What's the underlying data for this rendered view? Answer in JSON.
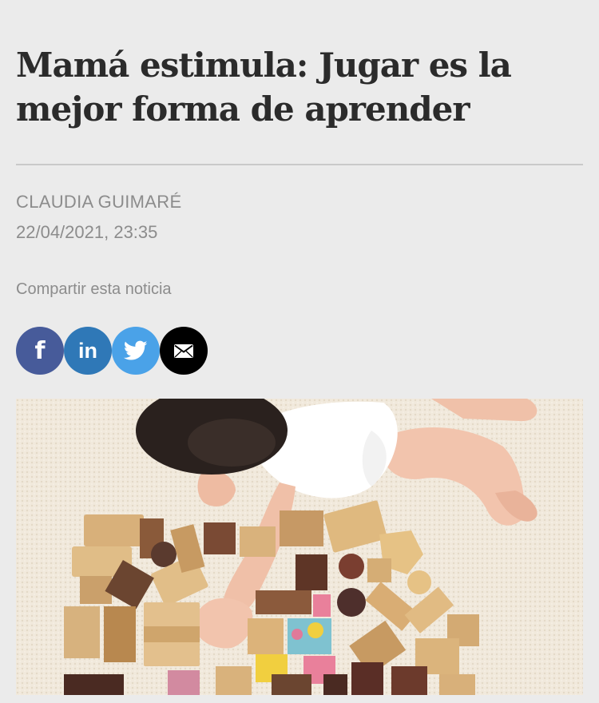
{
  "article": {
    "title": "Mamá estimula: Jugar es la mejor forma de aprender",
    "author": "CLAUDIA GUIMARÉ",
    "date": "22/04/2021, 23:35"
  },
  "share": {
    "label": "Compartir esta noticia",
    "buttons": [
      {
        "network": "facebook",
        "icon": "facebook-icon",
        "glyph": "f",
        "color": "#475b9a"
      },
      {
        "network": "linkedin",
        "icon": "linkedin-icon",
        "glyph": "in",
        "color": "#2f78b7"
      },
      {
        "network": "twitter",
        "icon": "twitter-icon",
        "color": "#4aa2e8"
      },
      {
        "network": "email",
        "icon": "mail-icon",
        "color": "#000000"
      }
    ]
  },
  "hero_image": {
    "subject": "photo-baby-playing-wooden-blocks"
  },
  "colors": {
    "background": "#ebebeb",
    "title": "#2b2b2b",
    "meta": "#8c8c8c",
    "divider": "#c9c9c9"
  }
}
